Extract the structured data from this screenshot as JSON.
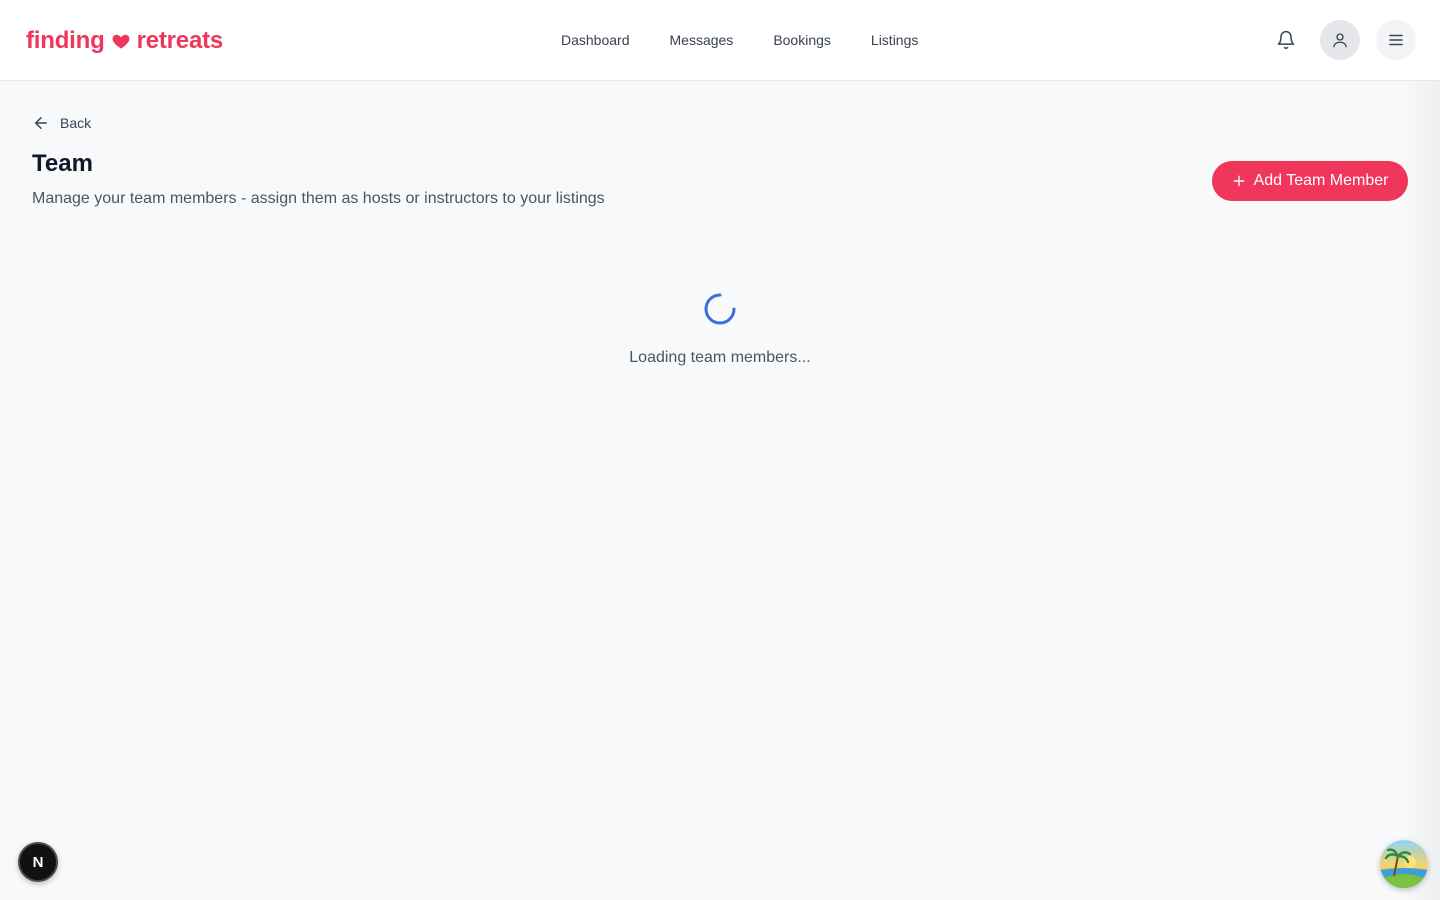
{
  "brand": {
    "name_left": "finding",
    "name_right": "retreats",
    "accent_color": "#f0365a",
    "heart_icon": "heart-icon"
  },
  "nav": {
    "items": [
      {
        "label": "Dashboard"
      },
      {
        "label": "Messages"
      },
      {
        "label": "Bookings"
      },
      {
        "label": "Listings"
      }
    ]
  },
  "header_actions": {
    "notifications_icon": "bell-icon",
    "user_icon": "user-icon",
    "menu_icon": "hamburger-menu-icon"
  },
  "page": {
    "back_label": "Back",
    "title": "Team",
    "subtitle": "Manage your team members - assign them as hosts or instructors to your listings",
    "add_button_label": "Add Team Member"
  },
  "loading": {
    "text": "Loading team members...",
    "spinner_color": "#3b6fe0"
  },
  "overlays": {
    "dev_badge_letter": "N",
    "beach_badge_icon": "palm-beach-icon"
  }
}
